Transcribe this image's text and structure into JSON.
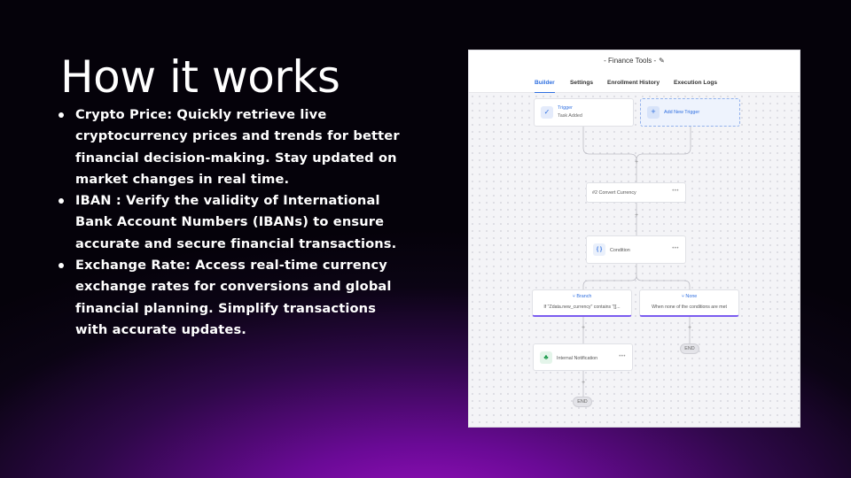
{
  "slide": {
    "title": "How it works",
    "bullets": [
      "Crypto Price: Quickly retrieve live cryptocurrency prices and trends for better financial decision-making. Stay updated on market changes in real time.",
      "IBAN : Verify the validity of International Bank Account Numbers (IBANs) to ensure accurate and secure financial transactions.",
      "Exchange Rate: Access real-time currency exchange rates for conversions and global financial planning. Simplify transactions with accurate updates."
    ]
  },
  "app": {
    "title": "- Finance Tools -",
    "edit_icon": "pencil-icon",
    "tabs": [
      "Builder",
      "Settings",
      "Enrollment History",
      "Execution Logs"
    ],
    "active_tab": "Builder"
  },
  "workflow": {
    "trigger": {
      "title": "Trigger",
      "subtitle": "Task Added",
      "icon": "check-icon"
    },
    "add_trigger": {
      "label": "Add New Trigger",
      "icon": "plus-icon"
    },
    "convert_currency": {
      "label": "#2 Convert Currency"
    },
    "condition": {
      "label": "Condition",
      "icon": "braces-icon"
    },
    "branch": {
      "title": "Branch",
      "description": "If \"Zdata.new_currency\" contains \"[[..."
    },
    "none": {
      "title": "None",
      "description": "When none of the conditions are met"
    },
    "notification": {
      "label": "Internal Notification",
      "icon": "bell-icon"
    },
    "end_label": "END",
    "more_label": "•••",
    "plus_label": "+"
  },
  "colors": {
    "accent": "#2f6fe0",
    "branch_accent": "#7b5cf0",
    "notification_green": "#1a9a4a"
  }
}
